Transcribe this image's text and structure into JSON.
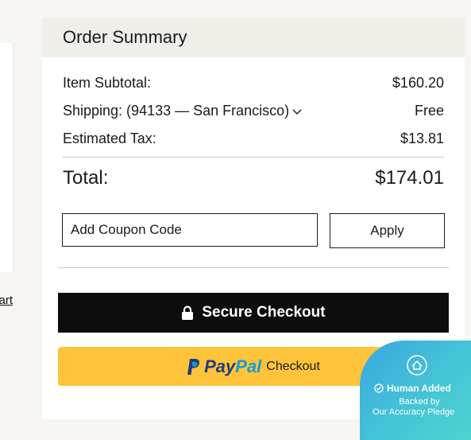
{
  "left_panel": {
    "cart_link_text": "art"
  },
  "order_summary": {
    "title": "Order Summary",
    "item_subtotal_label": "Item Subtotal:",
    "item_subtotal_value": "$160.20",
    "shipping_label": "Shipping:  (94133 — San Francisco)",
    "shipping_value": "Free",
    "tax_label": "Estimated Tax:",
    "tax_value": "$13.81",
    "total_label": "Total:",
    "total_value": "$174.01",
    "coupon_placeholder": "Add Coupon Code",
    "apply_label": "Apply",
    "secure_checkout_label": "Secure Checkout",
    "paypal": {
      "pay": "Pay",
      "pal": "Pal",
      "checkout_label": "Checkout"
    }
  },
  "badge": {
    "title": "Human Added",
    "line1": "Backed by",
    "line2": "Our Accuracy Pledge"
  },
  "icons": [
    "lock-icon",
    "chevron-down-icon",
    "paypal-logo-icon",
    "house-icon",
    "check-circle-icon"
  ],
  "colors": {
    "checkout_bg": "#0d0d0d",
    "paypal_bg": "#ffc439",
    "badge_bg": "#45c5d6"
  }
}
